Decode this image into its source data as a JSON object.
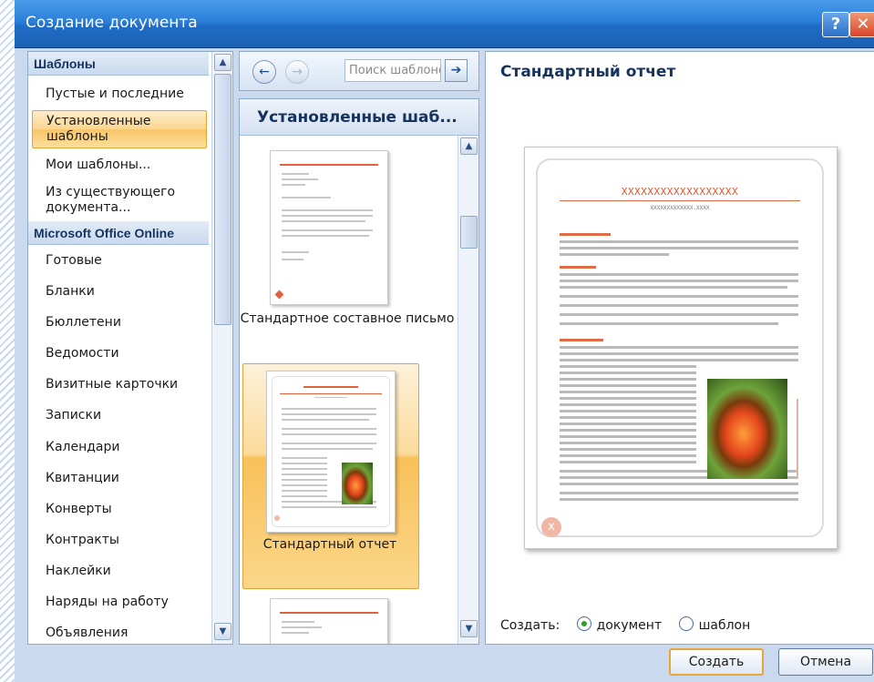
{
  "window": {
    "title": "Создание документа",
    "help_label": "?",
    "close_label": "✕"
  },
  "left": {
    "sections": [
      {
        "header": "Шаблоны"
      },
      {
        "header": "Microsoft Office Online"
      }
    ],
    "items": [
      "Пустые и последние",
      "Установленные шаблоны",
      "Мои шаблоны...",
      "Из существующего документа...",
      "Готовые",
      "Бланки",
      "Бюллетени",
      "Ведомости",
      "Визитные карточки",
      "Записки",
      "Календари",
      "Квитанции",
      "Конверты",
      "Контракты",
      "Наклейки",
      "Наряды на работу",
      "Объявления"
    ],
    "selected_index": 1
  },
  "nav": {
    "back_icon": "←",
    "forward_icon": "→",
    "search_placeholder": "Поиск шаблонов",
    "go_icon": "➔"
  },
  "middle": {
    "header": "Установленные шаб...",
    "templates": [
      {
        "label": "Стандартное составное письмо"
      },
      {
        "label": "Стандартный отчет",
        "selected": true
      },
      {
        "label": ""
      }
    ]
  },
  "preview": {
    "title": "Стандартный отчет",
    "doc_heading": "XXXXXXXXXXXXXXXXXX",
    "doc_sub": "XXXXXXXXXXXXX.XXXX"
  },
  "create": {
    "label": "Создать:",
    "options": [
      {
        "label": "документ",
        "selected": true
      },
      {
        "label": "шаблон",
        "selected": false
      }
    ]
  },
  "buttons": {
    "create": "Создать",
    "cancel": "Отмена"
  },
  "colors": {
    "accent": "#e2603c",
    "selection": "#fbd58e",
    "title_blue": "#15335c"
  }
}
